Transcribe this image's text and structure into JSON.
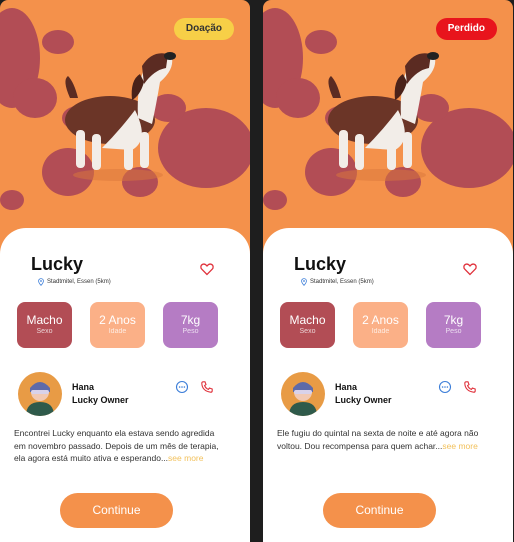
{
  "colors": {
    "background": "#f4914b",
    "paw": "#b24d55",
    "adopt_badge": "#f7cf47",
    "lost_badge": "#e8141c",
    "see_more": "#f2c15c"
  },
  "screens": [
    {
      "badge": "Doação",
      "pet": {
        "name": "Lucky",
        "location": "Stadtmitel, Essen (5km)"
      },
      "stats": [
        {
          "value": "Macho",
          "label": "Sexo"
        },
        {
          "value": "2 Anos",
          "label": "Idade"
        },
        {
          "value": "7kg",
          "label": "Peso"
        }
      ],
      "owner": {
        "name": "Hana",
        "role": "Lucky Owner"
      },
      "description": "Encontrei Lucky enquanto ela estava sendo agredida em novembro passado. Depois de um mês de terapia, ela agora está muito ativa e esperando...",
      "see_more": "see more",
      "button": "Continue"
    },
    {
      "badge": "Perdido",
      "pet": {
        "name": "Lucky",
        "location": "Stadtmitel, Essen (5km)"
      },
      "stats": [
        {
          "value": "Macho",
          "label": "Sexo"
        },
        {
          "value": "2 Anos",
          "label": "Idade"
        },
        {
          "value": "7kg",
          "label": "Peso"
        }
      ],
      "owner": {
        "name": "Hana",
        "role": "Lucky Owner"
      },
      "description": "Ele fugiu do quintal na sexta de noite e até agora não voltou. Dou recompensa para quem achar...",
      "see_more": "see more",
      "button": "Continue"
    }
  ]
}
